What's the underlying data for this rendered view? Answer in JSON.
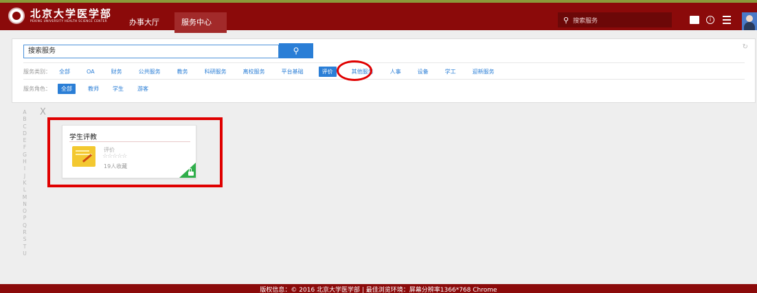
{
  "colors": {
    "brand": "#8b0a0a",
    "accent": "#2a7ed6",
    "annotation": "#e00000",
    "lock": "#2fae4a"
  },
  "header": {
    "logo_text": "北京大学医学部",
    "logo_subtext": "PEKING UNIVERSITY HEALTH SCIENCE CENTER",
    "tabs": [
      {
        "label": "办事大厅"
      },
      {
        "label": "服务中心"
      }
    ],
    "active_tab": "服务中心",
    "search_placeholder": "搜索服务",
    "icons": [
      "search-icon",
      "message-icon",
      "info-icon",
      "menu-icon",
      "avatar"
    ]
  },
  "filter": {
    "search_placeholder": "搜索服务",
    "categories_label": "服务类别：",
    "categories": [
      "全部",
      "OA",
      "财务",
      "公共服务",
      "教务",
      "科研服务",
      "离校服务",
      "平台基础",
      "评价",
      "其他服务",
      "人事",
      "设备",
      "学工",
      "迎新服务"
    ],
    "selected_category": "评价",
    "roles_label": "服务角色：",
    "roles": [
      "全部",
      "教师",
      "学生",
      "游客"
    ],
    "selected_role": "全部"
  },
  "alphabet": [
    "A",
    "B",
    "C",
    "D",
    "E",
    "F",
    "G",
    "H",
    "I",
    "J",
    "K",
    "L",
    "M",
    "N",
    "O",
    "P",
    "Q",
    "R",
    "S",
    "T",
    "U"
  ],
  "close_label": "X",
  "service_card": {
    "title": "学生评教",
    "category": "评价",
    "rating_stars": "☆☆☆☆☆",
    "rating": 0,
    "favorites": "19人收藏"
  },
  "footer": {
    "text": "版权信息：© 2016 北京大学医学部 | 最佳浏览环境：屏幕分辨率1366*768 Chrome"
  }
}
